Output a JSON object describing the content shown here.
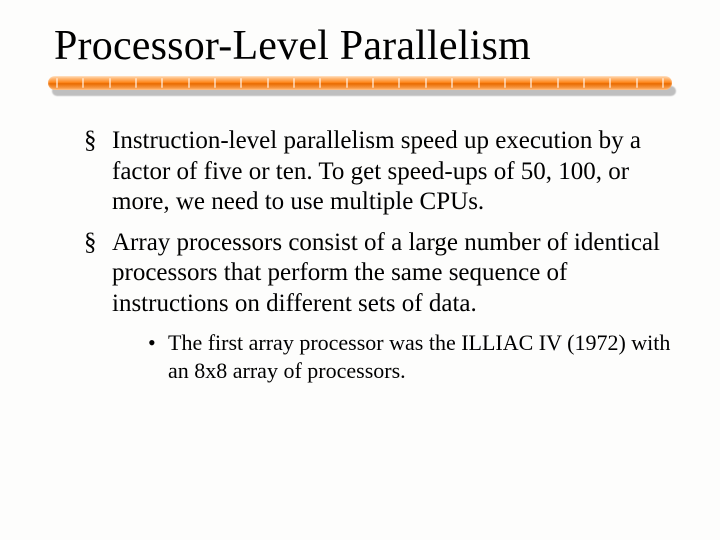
{
  "title": "Processor-Level Parallelism",
  "bullets": [
    {
      "text": "Instruction-level parallelism speed up execution by a factor of five or ten. To get speed-ups of 50, 100, or more, we need to use multiple CPUs."
    },
    {
      "text": "Array processors consist of a large number of identical processors that perform the same sequence of instructions on different sets of data.",
      "sub": [
        {
          "text": "The first array processor was the ILLIAC IV (1972) with an 8x8 array of processors."
        }
      ]
    }
  ]
}
